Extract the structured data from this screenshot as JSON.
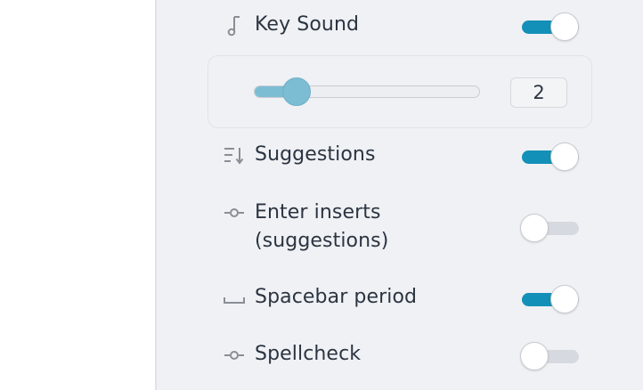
{
  "settings": {
    "key_sound": {
      "label": "Key Sound",
      "icon": "music-note-icon",
      "enabled": true
    },
    "key_sound_volume": {
      "value": "2",
      "level": 0.16
    },
    "suggestions": {
      "label": "Suggestions",
      "icon": "sort-down-icon",
      "enabled": true
    },
    "enter_inserts": {
      "label_line1": "Enter inserts",
      "label_line2": "(suggestions)",
      "icon": "commit-icon",
      "enabled": false
    },
    "spacebar_period": {
      "label": "Spacebar period",
      "icon": "space-bar-icon",
      "enabled": true
    },
    "spellcheck": {
      "label": "Spellcheck",
      "icon": "commit-icon",
      "enabled": false
    }
  },
  "colors": {
    "toggle_on": "#1390b8",
    "toggle_off": "#d6d9df",
    "slider": "#7dbdd3",
    "panel_bg": "#eff1f4",
    "text": "#2b3441"
  }
}
